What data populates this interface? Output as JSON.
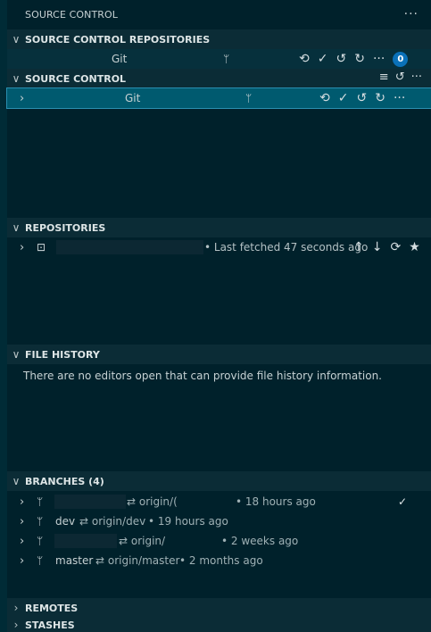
{
  "view": {
    "title": "SOURCE CONTROL",
    "more_icon": "ellipsis-icon"
  },
  "sections": {
    "repositories_header": "SOURCE CONTROL REPOSITORIES",
    "source_control_header": "SOURCE CONTROL",
    "repos_header": "REPOSITORIES",
    "file_history_header": "FILE HISTORY",
    "branches_header": "BRANCHES (4)",
    "remotes_header": "REMOTES",
    "stashes_header": "STASHES"
  },
  "scm_repo_row": {
    "label": "Git",
    "badge": "0"
  },
  "scm_row": {
    "label": "Git"
  },
  "repository": {
    "status": "• Last fetched 47 seconds ago"
  },
  "file_history": {
    "message": "There are no editors open that can provide file history information."
  },
  "branches": [
    {
      "name": "",
      "tracking": "⇄ origin/(",
      "age": "• 18 hours ago",
      "checked": true
    },
    {
      "name": "dev",
      "tracking": "⇄ origin/dev",
      "age": "• 19 hours ago",
      "checked": false
    },
    {
      "name": "",
      "tracking": "⇄ origin/",
      "age": "• 2 weeks ago",
      "checked": false
    },
    {
      "name": "master",
      "tracking": "⇄ origin/master",
      "age": "• 2 months ago",
      "checked": false
    }
  ],
  "colors": {
    "background": "#00212b",
    "section_header": "#0b2c36",
    "selected_row": "#005a6f",
    "badge": "#0a71b8"
  }
}
